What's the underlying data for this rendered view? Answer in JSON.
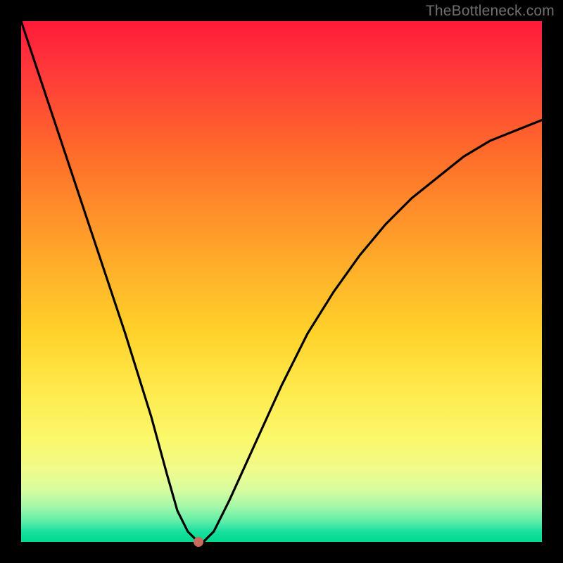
{
  "watermark": "TheBottleneck.com",
  "chart_data": {
    "type": "line",
    "title": "",
    "xlabel": "",
    "ylabel": "",
    "xlim": [
      0,
      100
    ],
    "ylim": [
      0,
      100
    ],
    "grid": false,
    "legend": false,
    "background_gradient": [
      "#ff1a3a",
      "#ff6a2a",
      "#ffb12a",
      "#ffe84a",
      "#f0fb8a",
      "#60eea8",
      "#00d98f"
    ],
    "series": [
      {
        "name": "bottleneck-curve",
        "color": "#000000",
        "x": [
          0,
          5,
          10,
          15,
          20,
          25,
          28,
          30,
          32,
          33,
          34,
          35,
          37,
          40,
          45,
          50,
          55,
          60,
          65,
          70,
          75,
          80,
          85,
          90,
          95,
          100
        ],
        "y": [
          100,
          85,
          70,
          55,
          40,
          24,
          13,
          6,
          2,
          1,
          0,
          0,
          2,
          8,
          19,
          30,
          40,
          48,
          55,
          61,
          66,
          70,
          74,
          77,
          79,
          81
        ]
      }
    ],
    "marker": {
      "name": "optimal-point",
      "x": 34,
      "y": 0,
      "color": "#c96a5a"
    }
  }
}
